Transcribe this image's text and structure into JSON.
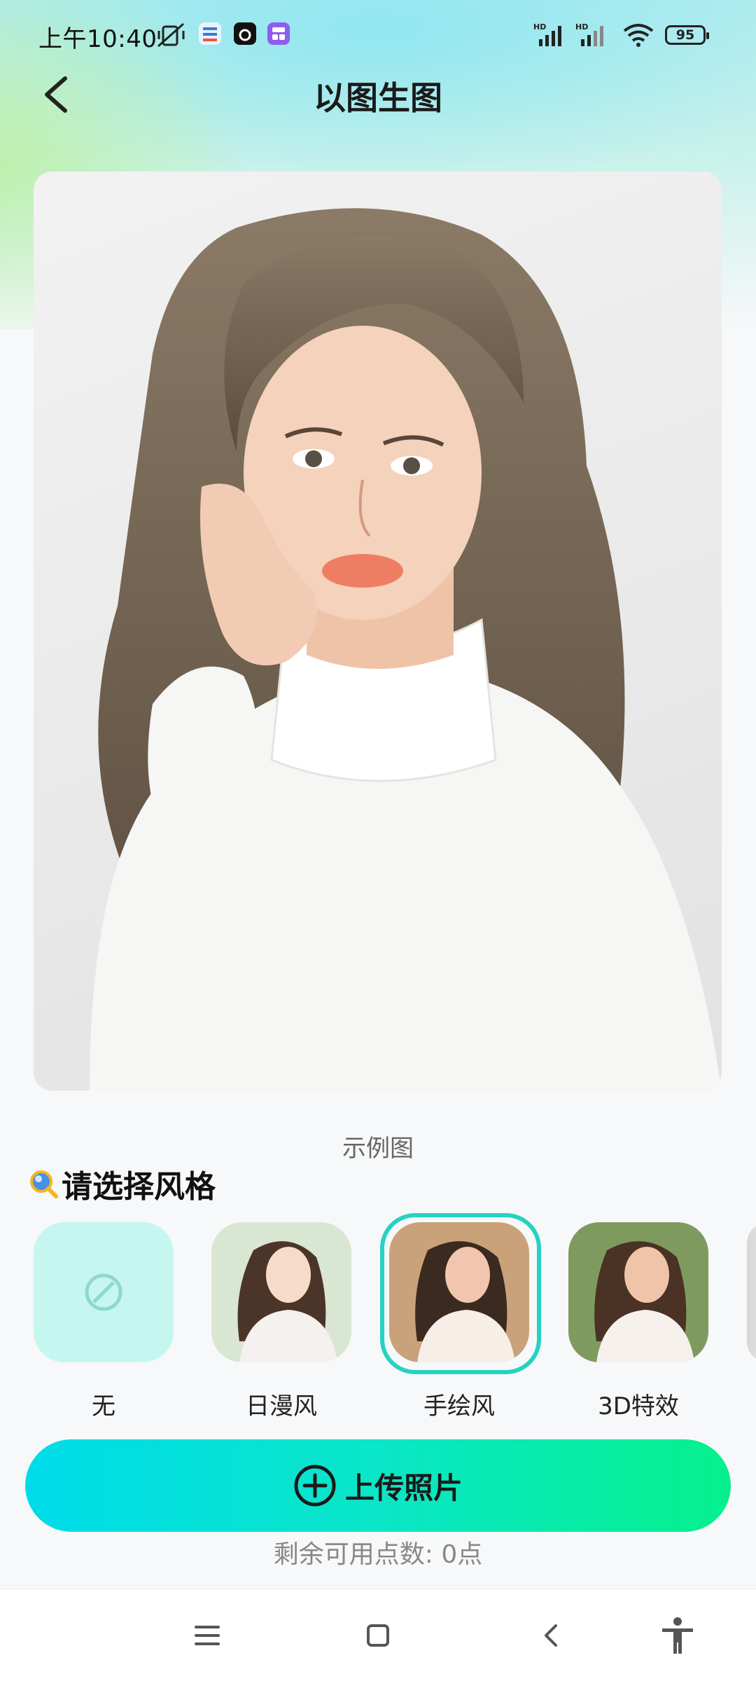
{
  "status_bar": {
    "time": "上午10:40",
    "battery": "95",
    "network_1": "HD",
    "network_2": "HD"
  },
  "header": {
    "title": "以图生图",
    "back_icon": "chevron-left-icon"
  },
  "example": {
    "caption": "示例图"
  },
  "styles": {
    "title": "请选择风格",
    "items": [
      {
        "label": "无",
        "icon": "prohibit-icon",
        "selected": false
      },
      {
        "label": "日漫风",
        "selected": false
      },
      {
        "label": "手绘风",
        "selected": true
      },
      {
        "label": "3D特效",
        "selected": false
      }
    ]
  },
  "upload": {
    "label": "上传照片",
    "icon": "plus-circle-icon"
  },
  "points": {
    "text": "剩余可用点数: 0点"
  },
  "nav": {
    "items": [
      "menu-icon",
      "home-icon",
      "back-icon",
      "accessibility-icon"
    ]
  },
  "colors": {
    "accent": "#26d2c2",
    "button_start": "#00dbea",
    "button_end": "#05f08c"
  }
}
